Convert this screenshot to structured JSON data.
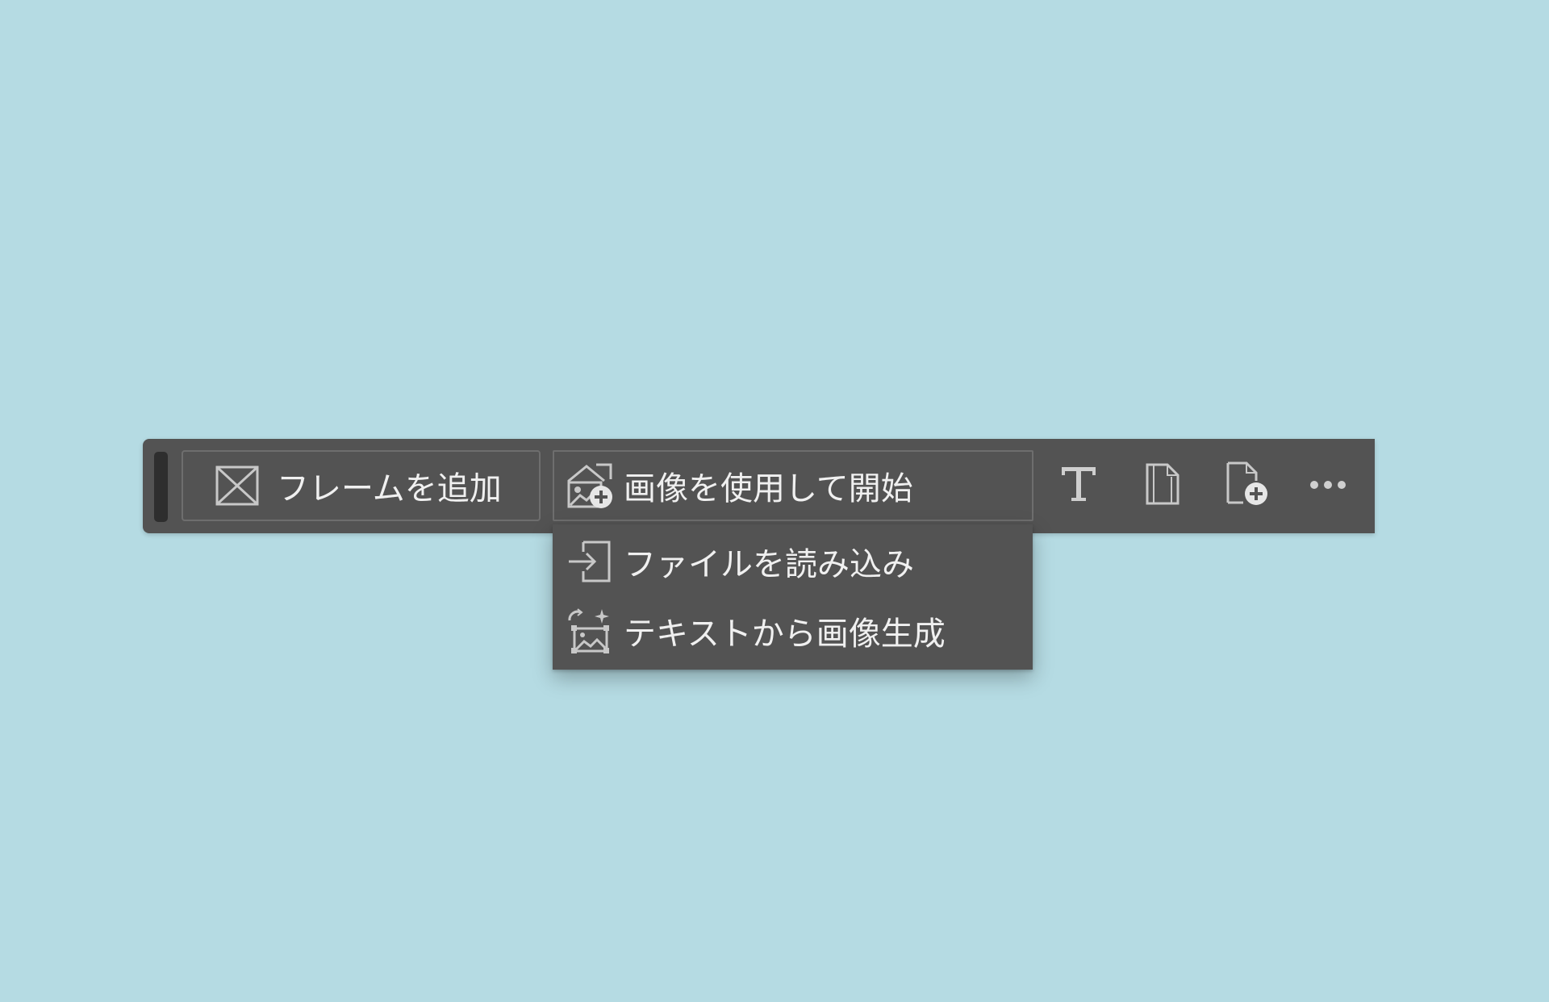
{
  "toolbar": {
    "add_frame_label": "フレームを追加",
    "start_with_image_label": "画像を使用して開始",
    "tools": [
      {
        "name": "text-tool",
        "icon": "text-t-icon"
      },
      {
        "name": "artboard-tool",
        "icon": "page-icon"
      },
      {
        "name": "add-page-tool",
        "icon": "add-page-icon"
      },
      {
        "name": "more-options",
        "icon": "more-dots-icon"
      }
    ]
  },
  "dropdown": {
    "items": [
      {
        "label": "ファイルを読み込み",
        "icon": "import-file-icon"
      },
      {
        "label": "テキストから画像生成",
        "icon": "text-to-image-icon"
      }
    ]
  },
  "colors": {
    "background": "#b5dbe3",
    "toolbar": "#535353",
    "grip": "#2e2e2e",
    "border": "#6e6e6e",
    "text": "#f0f0f0"
  }
}
